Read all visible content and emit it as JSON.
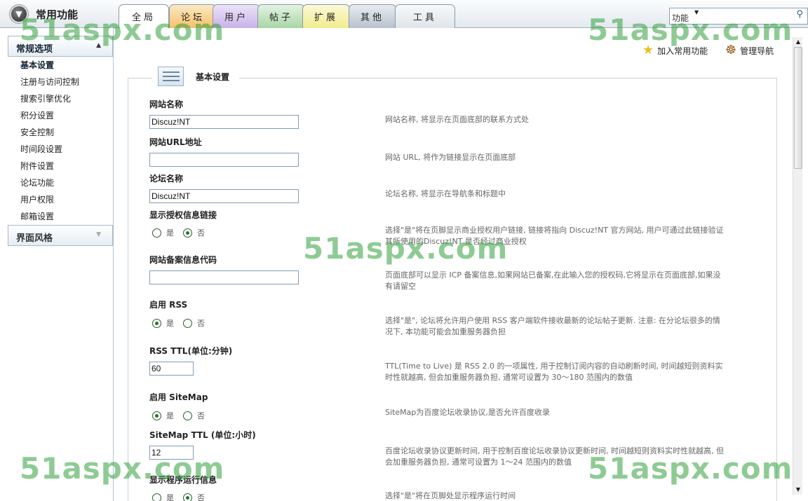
{
  "header": {
    "title": "常用功能",
    "back_icon": "arrow-down-circle-icon"
  },
  "tabs": [
    {
      "label": "全局",
      "color": "#ffffff",
      "active": true
    },
    {
      "label": "论坛",
      "color": "#f4c06a"
    },
    {
      "label": "用户",
      "color": "#c9b2e8"
    },
    {
      "label": "帖子",
      "color": "#a9d6a7"
    },
    {
      "label": "扩展",
      "color": "#f2ec8f"
    },
    {
      "label": "其他",
      "color": "#b7c2ce"
    },
    {
      "label": "工具",
      "color": "#dfe5ea"
    }
  ],
  "search": {
    "value": "功能",
    "icon": "search-icon"
  },
  "sidebar": {
    "section1": "常规选项",
    "items": [
      "基本设置",
      "注册与访问控制",
      "搜索引擎优化",
      "积分设置",
      "安全控制",
      "时间段设置",
      "附件设置",
      "论坛功能",
      "用户权限",
      "邮箱设置"
    ],
    "section2": "界面风格"
  },
  "toolbar": {
    "add_favorite": "加入常用功能",
    "admin_nav": "管理导航"
  },
  "legend": "基本设置",
  "fields": [
    {
      "label": "网站名称",
      "value": "Discuz!NT",
      "desc": [
        "网站名称, 将显示在页面底部的联系方式处"
      ]
    },
    {
      "label": "网站URL地址",
      "value": "",
      "desc": [
        "网站 URL, 将作为链接显示在页面底部"
      ]
    },
    {
      "label": "论坛名称",
      "value": "Discuz!NT",
      "desc": [
        "论坛名称, 将显示在导航条和标题中"
      ]
    },
    {
      "label": "显示授权信息链接",
      "radio": "no",
      "desc": [
        "选择\"是\"将在页脚显示商业授权用户链接, 链接将指向 Discuz!NT 官方网站, 用户可通过此链接验证",
        "其所使用的Discuz!NT 是否经过商业授权"
      ]
    },
    {
      "label": "网站备案信息代码",
      "value": "",
      "desc": [
        "页面底部可以显示 ICP 备案信息,如果网站已备案,在此输入您的授权码,它将显示在页面底部,如果没",
        "有请留空"
      ]
    },
    {
      "label": "启用 RSS",
      "radio": "yes",
      "desc": [
        "选择\"是\", 论坛将允许用户使用 RSS 客户端软件接收最新的论坛帖子更新. 注意: 在分论坛很多的情",
        "况下, 本功能可能会加重服务器负担"
      ]
    },
    {
      "label": "RSS TTL(单位:分钟)",
      "value": "60",
      "desc": [
        "TTL(Time to Live) 是 RSS 2.0 的一项属性, 用于控制订阅内容的自动刷新时间, 时间越短则资料实",
        "时性就越高, 但会加重服务器负担, 通常可设置为 30～180 范围内的数值"
      ]
    },
    {
      "label": "启用 SiteMap",
      "radio": "yes",
      "desc": [
        "SiteMap为百度论坛收录协议,是否允许百度收录"
      ]
    },
    {
      "label": "SiteMap TTL (单位:小时)",
      "value": "12",
      "desc": [
        "百度论坛收录协议更新时间, 用于控制百度论坛收录协议更新时间, 时间越短则资料实时性就越高, 但",
        "会加重服务器负担, 通常可设置为 1～24 范围内的数值"
      ]
    },
    {
      "label": "显示程序运行信息",
      "radio": "no",
      "desc": [
        "选择\"是\"将在页脚处显示程序运行时间"
      ]
    }
  ],
  "radio_labels": {
    "yes": "是",
    "no": "否"
  },
  "watermark": "51aspx.com"
}
